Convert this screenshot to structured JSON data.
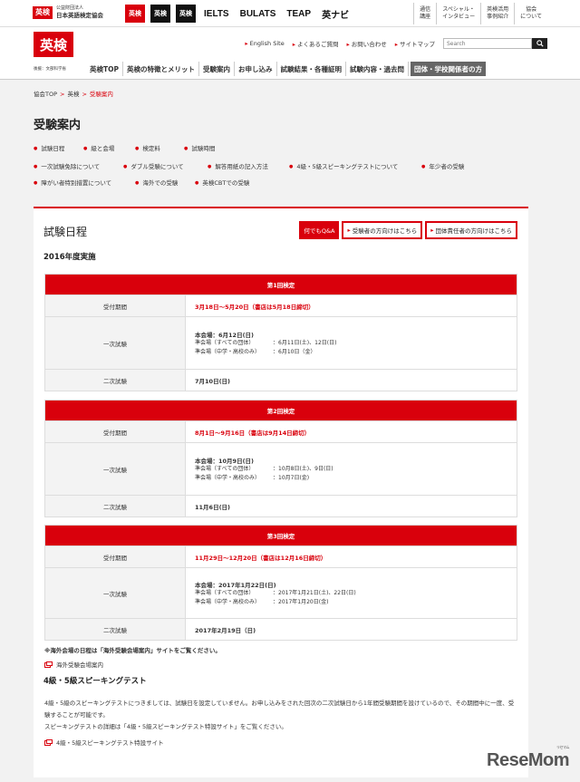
{
  "topbar": {
    "org_logo": "英検",
    "org_line1": "公益財団法人",
    "org_line2": "日本英語検定協会",
    "brands": [
      {
        "label": "英検",
        "style": "red"
      },
      {
        "label": "英検",
        "style": "dark"
      },
      {
        "label": "英検",
        "style": "dark"
      },
      {
        "label": "IELTS",
        "style": "text"
      },
      {
        "label": "BULATS",
        "style": "text"
      },
      {
        "label": "TEAP",
        "style": "text"
      },
      {
        "label": "英ナビ",
        "style": "text"
      }
    ],
    "links": [
      "通信\n講座",
      "スペシャル・\nインタビュー",
      "英検活用\n事例紹介",
      "協会\nについて"
    ]
  },
  "header": {
    "logo": "英検",
    "logo_sub": "後援：文部科学省",
    "utility_links": [
      "English Site",
      "よくあるご質問",
      "お問い合わせ",
      "サイトマップ"
    ],
    "search_placeholder": "Search",
    "gnav": [
      "英検TOP",
      "英検の特徴とメリット",
      "受験案内",
      "お申し込み",
      "試験結果・各種証明",
      "試験内容・過去問",
      "団体・学校関係者の方"
    ]
  },
  "breadcrumb": [
    "協会TOP",
    "英検",
    "受験案内"
  ],
  "page_title": "受験案内",
  "anchors": [
    "試験日程",
    "級と会場",
    "検定料",
    "試験時間",
    "一次試験免除について",
    "ダブル受験について",
    "解答用紙の記入方法",
    "4級・5級スピーキングテストについて",
    "年少者の受験",
    "障がい者特別措置について",
    "海外での受験",
    "英検CBTでの受験"
  ],
  "main": {
    "heading": "試験日程",
    "qa_button": "何でもQ&A",
    "examinee_button": "受験者の方向けはこちら",
    "group_button": "団体責任者の方向けはこちら",
    "year": "2016年度実施",
    "sessions": [
      {
        "title": "第1回検定",
        "reception_label": "受付期間",
        "reception": "3月18日～5月20日（書店は5月18日締切）",
        "first_label": "一次試験",
        "main_venue": "本会場：6月12日(日)",
        "sub1_label": "準会場（すべての団体）",
        "sub1_value": "：6月11日(土)、12日(日)",
        "sub2_label": "準会場（中学・高校のみ）",
        "sub2_value": "：6月10日（金）",
        "second_label": "二次試験",
        "second": "7月10日(日)"
      },
      {
        "title": "第2回検定",
        "reception_label": "受付期間",
        "reception": "8月1日～9月16日（書店は9月14日締切）",
        "first_label": "一次試験",
        "main_venue": "本会場：10月9日(日)",
        "sub1_label": "準会場（すべての団体）",
        "sub1_value": "：10月8日(土)、9日(日)",
        "sub2_label": "準会場（中学・高校のみ）",
        "sub2_value": "：10月7日(金)",
        "second_label": "二次試験",
        "second": "11月6日(日)"
      },
      {
        "title": "第3回検定",
        "reception_label": "受付期間",
        "reception": "11月29日～12月20日（書店は12月16日締切）",
        "first_label": "一次試験",
        "main_venue": "本会場：2017年1月22日(日)",
        "sub1_label": "準会場（すべての団体）",
        "sub1_value": "：2017年1月21日(土)、22日(日)",
        "sub2_label": "準会場（中学・高校のみ）",
        "sub2_value": "：2017年1月20日(金)",
        "second_label": "二次試験",
        "second": "2017年2月19日（日)"
      }
    ],
    "overseas_note": "※海外会場の日程は「海外受験会場案内」サイトをご覧ください。",
    "overseas_link": "海外受験会場案内",
    "speaking_heading": "4級・5級スピーキングテスト",
    "speaking_p1": "4級・5級のスピーキングテストにつきましては、試験日を設定していません。お申し込みをされた回次の二次試験日から1年間受験期間を設けているので、その期間中に一度、受験することが可能です。",
    "speaking_p2": "スピーキングテストの詳細は「4級・5級スピーキングテスト特設サイト」をご覧ください。",
    "speaking_link": "4級・5級スピーキングテスト特設サイト"
  },
  "watermark": {
    "main": "ReseMom",
    "sub": "リセマム"
  },
  "colors": {
    "accent": "#d9000c",
    "nav_special": "#666666"
  }
}
